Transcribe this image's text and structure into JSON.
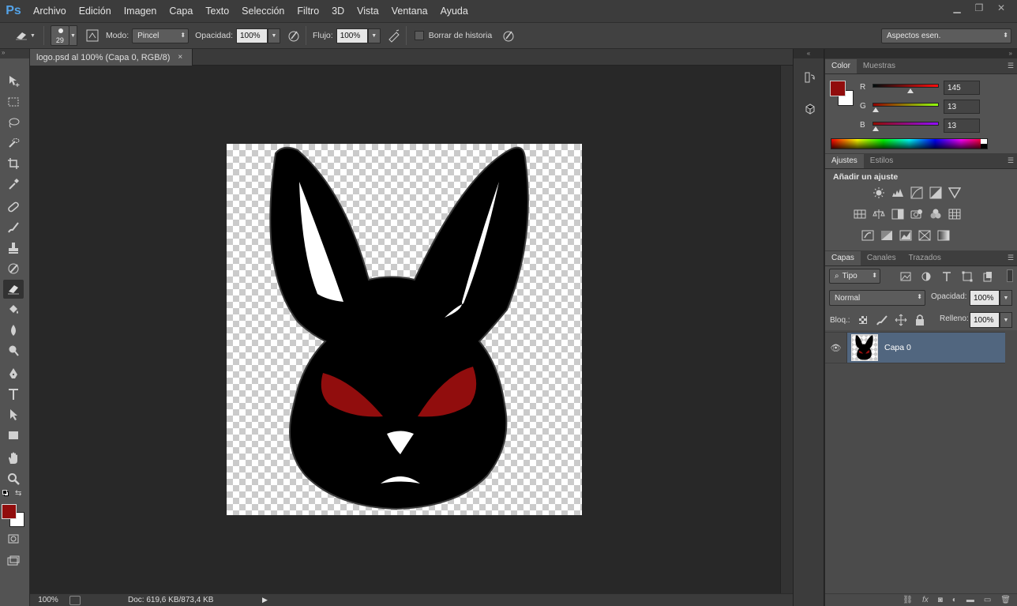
{
  "app": {
    "logo": "Ps"
  },
  "menu": [
    "Archivo",
    "Edición",
    "Imagen",
    "Capa",
    "Texto",
    "Selección",
    "Filtro",
    "3D",
    "Vista",
    "Ventana",
    "Ayuda"
  ],
  "window_controls": [
    "minimize-icon",
    "restore-icon",
    "close-icon"
  ],
  "options": {
    "brush_size": "29",
    "mode_label": "Modo:",
    "mode_value": "Pincel",
    "opacity_label": "Opacidad:",
    "opacity_value": "100%",
    "flow_label": "Flujo:",
    "flow_value": "100%",
    "erase_history_label": "Borrar de historia",
    "workspace_value": "Aspectos esen."
  },
  "document": {
    "tab_title": "logo.psd al 100% (Capa 0, RGB/8)",
    "close": "×"
  },
  "status": {
    "zoom": "100%",
    "doc_info": "Doc: 619,6 KB/873,4 KB"
  },
  "color_panel": {
    "tabs": [
      "Color",
      "Muestras"
    ],
    "channels": [
      {
        "name": "R",
        "value": "145",
        "fraction": 0.569
      },
      {
        "name": "G",
        "value": "13",
        "fraction": 0.051
      },
      {
        "name": "B",
        "value": "13",
        "fraction": 0.051
      }
    ],
    "foreground": "#910d0d",
    "background": "#ffffff"
  },
  "adjustments_panel": {
    "tabs": [
      "Ajustes",
      "Estilos"
    ],
    "heading": "Añadir un ajuste"
  },
  "layers_panel": {
    "tabs": [
      "Capas",
      "Canales",
      "Trazados"
    ],
    "filter_label": "Tipo",
    "blend_mode": "Normal",
    "opacity_label": "Opacidad:",
    "opacity_value": "100%",
    "lock_label": "Bloq.:",
    "fill_label": "Relleno:",
    "fill_value": "100%",
    "layers": [
      {
        "name": "Capa 0",
        "visible": true,
        "selected": true
      }
    ]
  },
  "colors": {
    "accent_selected": "#51667f",
    "eye_red": "#910d0d"
  }
}
